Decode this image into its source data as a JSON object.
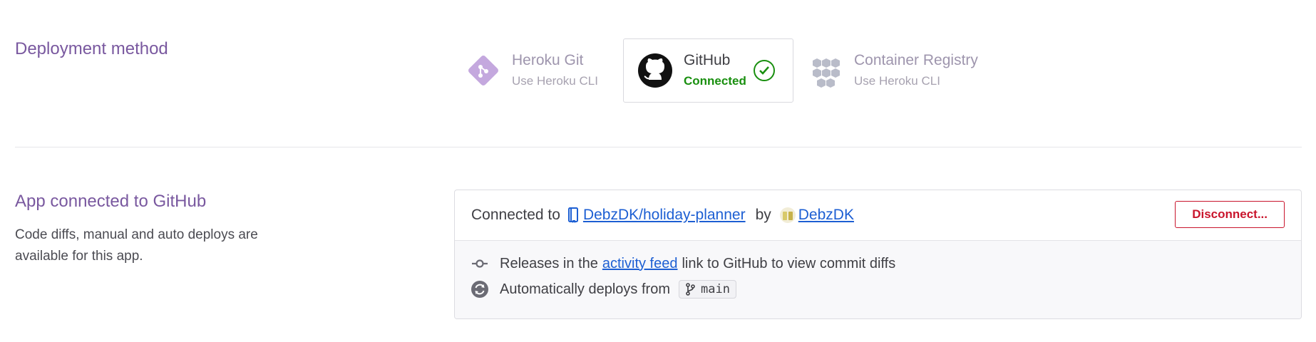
{
  "deployment": {
    "title": "Deployment method",
    "methods": [
      {
        "name": "Heroku Git",
        "sub": "Use Heroku CLI",
        "icon": "heroku-git-icon"
      },
      {
        "name": "GitHub",
        "sub": "Connected",
        "icon": "github-icon"
      },
      {
        "name": "Container Registry",
        "sub": "Use Heroku CLI",
        "icon": "container-registry-icon"
      }
    ]
  },
  "connection": {
    "title": "App connected to GitHub",
    "description": "Code diffs, manual and auto deploys are available for this app.",
    "connected_to": "Connected to",
    "repo": "DebzDK/holiday-planner",
    "by": "by",
    "user": "DebzDK",
    "disconnect_label": "Disconnect...",
    "releases": {
      "before": "Releases in the",
      "link": "activity feed",
      "after": "link to GitHub to view commit diffs"
    },
    "auto_deploy": {
      "text": "Automatically deploys from",
      "branch": "main"
    }
  },
  "colors": {
    "accent": "#79589f",
    "connected": "#198f0f",
    "link": "#1d5fd3",
    "danger": "#c9152c"
  }
}
